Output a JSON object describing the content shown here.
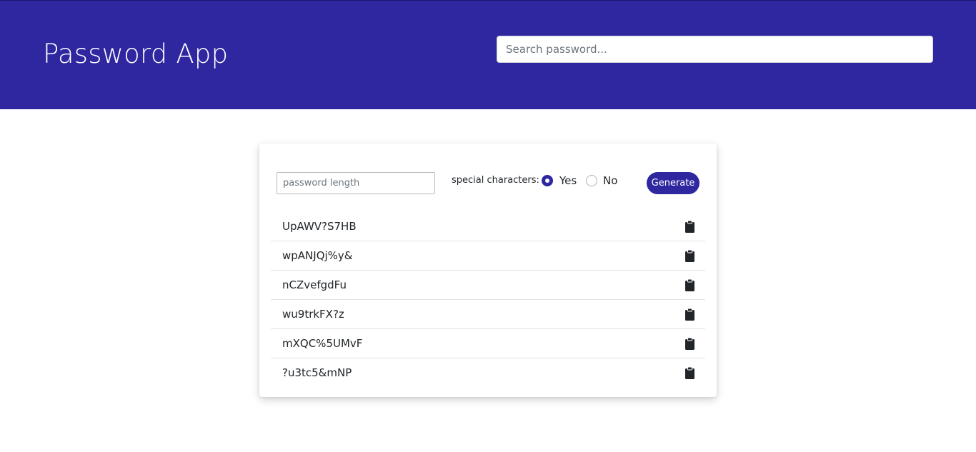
{
  "header": {
    "title": "Password App",
    "background_color": "#2e27a0"
  },
  "search": {
    "placeholder": "Search password...",
    "value": ""
  },
  "generator": {
    "length_placeholder": "password length",
    "length_value": "",
    "special_label": "special characters:",
    "options": [
      {
        "label": "Yes",
        "selected": true
      },
      {
        "label": "No",
        "selected": false
      }
    ],
    "generate_label": "Generate",
    "accent_color": "#2e27a0"
  },
  "passwords": [
    {
      "value": "UpAWV?S7HB",
      "icon": "clipboard-icon"
    },
    {
      "value": "wpANJQj%y&",
      "icon": "clipboard-icon"
    },
    {
      "value": "nCZvefgdFu",
      "icon": "clipboard-icon"
    },
    {
      "value": "wu9trkFX?z",
      "icon": "clipboard-icon"
    },
    {
      "value": "mXQC%5UMvF",
      "icon": "clipboard-icon"
    },
    {
      "value": "?u3tc5&mNP",
      "icon": "clipboard-icon"
    }
  ]
}
